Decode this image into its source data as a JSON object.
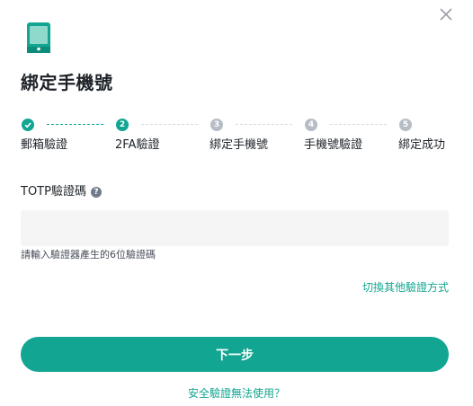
{
  "dialog": {
    "title": "綁定手機號"
  },
  "steps": [
    {
      "number": "",
      "label": "郵箱驗證",
      "state": "done"
    },
    {
      "number": "2",
      "label": "2FA驗證",
      "state": "active"
    },
    {
      "number": "3",
      "label": "綁定手機號",
      "state": "todo"
    },
    {
      "number": "4",
      "label": "手機號驗證",
      "state": "todo"
    },
    {
      "number": "5",
      "label": "綁定成功",
      "state": "todo"
    }
  ],
  "form": {
    "totp_label": "TOTP驗證碼",
    "totp_value": "",
    "totp_placeholder": "",
    "hint": "請輸入驗證器產生的6位驗證碼",
    "switch_method": "切換其他驗證方式"
  },
  "actions": {
    "next_label": "下一步",
    "unavailable_link": "安全驗證無法使用？"
  },
  "colors": {
    "accent": "#12a591",
    "step_inactive": "#b7bdc6",
    "input_bg": "#f5f5f5"
  },
  "icons": {
    "close": "close-icon",
    "phone": "phone-icon",
    "check": "check-icon",
    "help": "question-circle-icon"
  }
}
